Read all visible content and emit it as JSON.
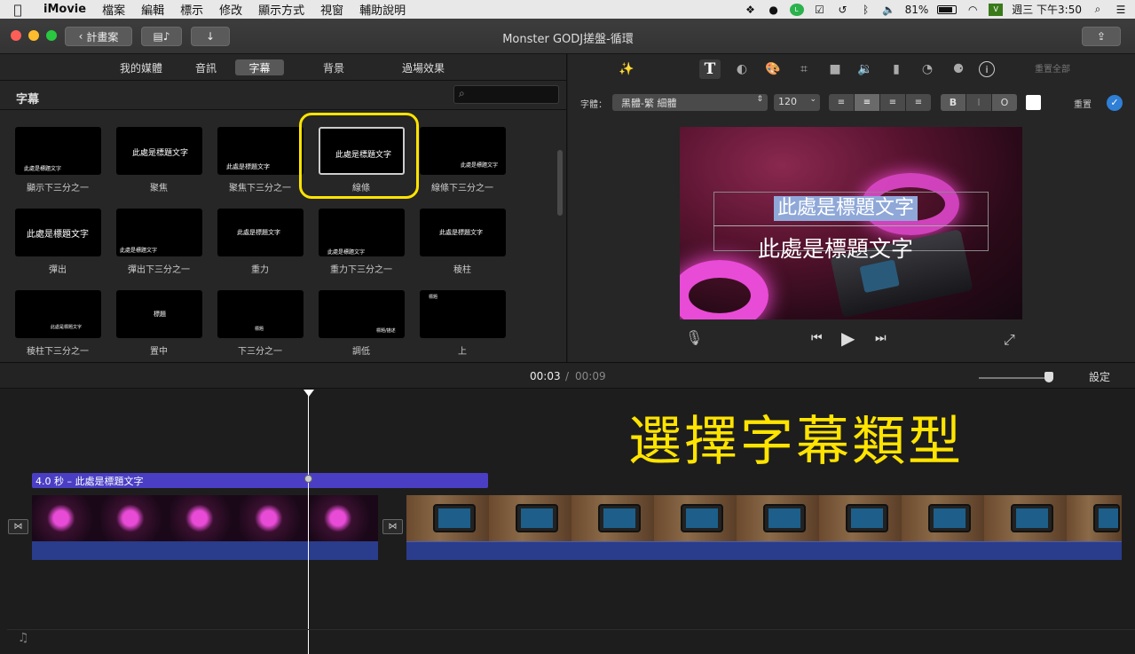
{
  "menubar": {
    "items": [
      "iMovie",
      "檔案",
      "編輯",
      "標示",
      "修改",
      "顯示方式",
      "視窗",
      "輔助說明"
    ],
    "battery": "81%",
    "clock": "週三 下午3:50"
  },
  "titlebar": {
    "back_label": "計畫案",
    "title": "Monster GODJ搓盤-循環"
  },
  "browser": {
    "tabs": [
      "我的媒體",
      "音訊",
      "字幕",
      "背景",
      "過場效果"
    ],
    "active_tab": "字幕",
    "section_title": "字幕",
    "search_placeholder": "",
    "tiles": [
      {
        "label": "顯示下三分之一",
        "text": "此處是標題文字"
      },
      {
        "label": "聚焦",
        "text": "此處是標題文字"
      },
      {
        "label": "聚焦下三分之一",
        "text": "此處是標題文字"
      },
      {
        "label": "線條",
        "text": "此處是標題文字",
        "selected": true
      },
      {
        "label": "線條下三分之一",
        "text": "此處是標題文字"
      },
      {
        "label": "彈出",
        "text": "此處是標題文字"
      },
      {
        "label": "彈出下三分之一",
        "text": "此處是標題文字"
      },
      {
        "label": "重力",
        "text": "此處是標題文字"
      },
      {
        "label": "重力下三分之一",
        "text": "此處是標題文字"
      },
      {
        "label": "稜柱",
        "text": "此處是標題文字"
      },
      {
        "label": "稜柱下三分之一",
        "text": "此處是標題文字"
      },
      {
        "label": "置中",
        "text": "標題"
      },
      {
        "label": "下三分之一",
        "text": "標題"
      },
      {
        "label": "調低",
        "text": "標題/描述"
      },
      {
        "label": "上",
        "text": "標題"
      }
    ]
  },
  "viewer": {
    "reset_all_label": "重置全部",
    "font_label": "字體：",
    "font_value": "黑體-繁 細體",
    "font_size": "120",
    "style_bold": "B",
    "style_italic": "I",
    "style_outline": "O",
    "reset_label": "重置",
    "preview_title": "此處是標題文字",
    "preview_subtitle": "此處是標題文字"
  },
  "timeline": {
    "current_time": "00:03",
    "separator": "/",
    "total_time": "00:09",
    "settings_label": "設定",
    "title_clip_label": "4.0 秒 – 此處是標題文字",
    "annotation": "選擇字幕類型"
  },
  "colors": {
    "highlight": "#ffe400",
    "title_clip": "#4a3fc4",
    "audio": "#2a3c8c",
    "accent": "#2f7fd6"
  }
}
